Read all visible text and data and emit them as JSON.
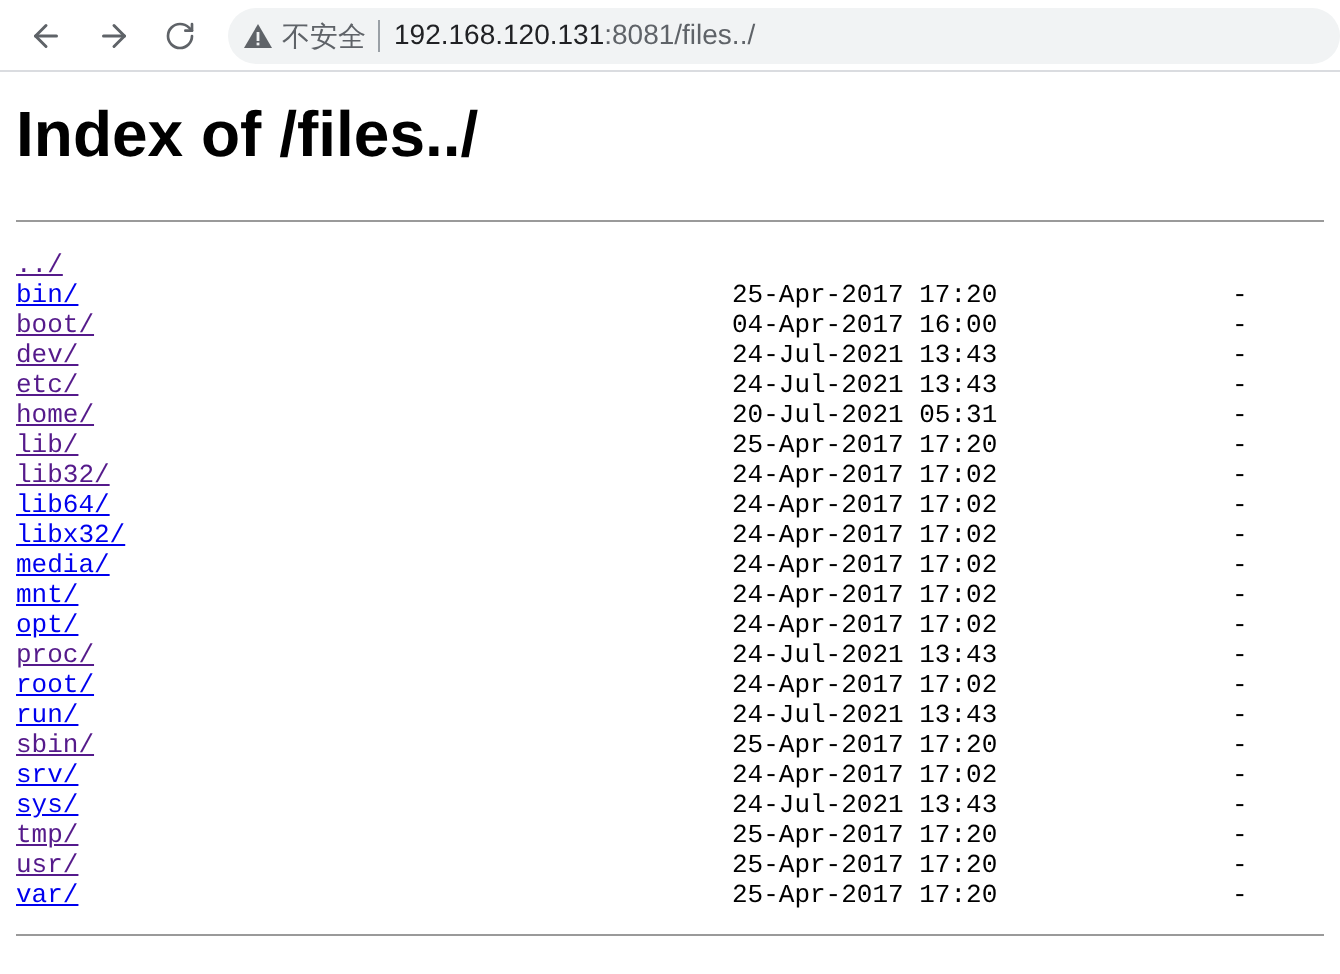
{
  "toolbar": {
    "security_label": "不安全",
    "url_host": "192.168.120.131",
    "url_path": ":8081/files../"
  },
  "heading": "Index of /files../",
  "entries": [
    {
      "name": "../",
      "visited": true
    },
    {
      "name": "bin/",
      "visited": false,
      "date": "25-Apr-2017 17:20",
      "size": "-"
    },
    {
      "name": "boot/",
      "visited": true,
      "date": "04-Apr-2017 16:00",
      "size": "-"
    },
    {
      "name": "dev/",
      "visited": true,
      "date": "24-Jul-2021 13:43",
      "size": "-"
    },
    {
      "name": "etc/",
      "visited": true,
      "date": "24-Jul-2021 13:43",
      "size": "-"
    },
    {
      "name": "home/",
      "visited": true,
      "date": "20-Jul-2021 05:31",
      "size": "-"
    },
    {
      "name": "lib/",
      "visited": true,
      "date": "25-Apr-2017 17:20",
      "size": "-"
    },
    {
      "name": "lib32/",
      "visited": true,
      "date": "24-Apr-2017 17:02",
      "size": "-"
    },
    {
      "name": "lib64/",
      "visited": false,
      "date": "24-Apr-2017 17:02",
      "size": "-"
    },
    {
      "name": "libx32/",
      "visited": false,
      "date": "24-Apr-2017 17:02",
      "size": "-"
    },
    {
      "name": "media/",
      "visited": false,
      "date": "24-Apr-2017 17:02",
      "size": "-"
    },
    {
      "name": "mnt/",
      "visited": false,
      "date": "24-Apr-2017 17:02",
      "size": "-"
    },
    {
      "name": "opt/",
      "visited": false,
      "date": "24-Apr-2017 17:02",
      "size": "-"
    },
    {
      "name": "proc/",
      "visited": true,
      "date": "24-Jul-2021 13:43",
      "size": "-"
    },
    {
      "name": "root/",
      "visited": false,
      "date": "24-Apr-2017 17:02",
      "size": "-"
    },
    {
      "name": "run/",
      "visited": false,
      "date": "24-Jul-2021 13:43",
      "size": "-"
    },
    {
      "name": "sbin/",
      "visited": true,
      "date": "25-Apr-2017 17:20",
      "size": "-"
    },
    {
      "name": "srv/",
      "visited": false,
      "date": "24-Apr-2017 17:02",
      "size": "-"
    },
    {
      "name": "sys/",
      "visited": false,
      "date": "24-Jul-2021 13:43",
      "size": "-"
    },
    {
      "name": "tmp/",
      "visited": true,
      "date": "25-Apr-2017 17:20",
      "size": "-"
    },
    {
      "name": "usr/",
      "visited": true,
      "date": "25-Apr-2017 17:20",
      "size": "-"
    },
    {
      "name": "var/",
      "visited": false,
      "date": "25-Apr-2017 17:20",
      "size": "-"
    }
  ]
}
